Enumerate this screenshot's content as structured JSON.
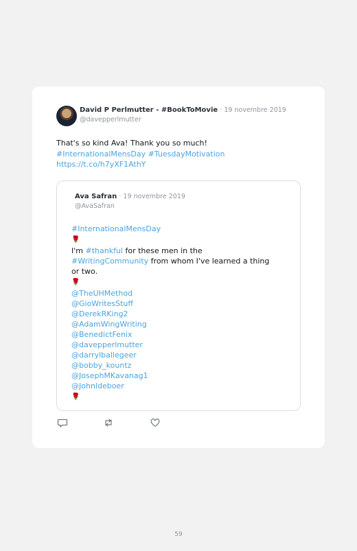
{
  "tweet": {
    "author_name": "David P Perlmutter - #BookToMovie",
    "date": "19 novembre 2019",
    "handle": "@davepperlmutter",
    "text_line1": "That's so kind Ava! Thank you so much!",
    "hashtag1": "#InternationalMensDay",
    "hashtag2": "#TuesdayMotivation",
    "link": "https://t.co/h7yXF1AthY"
  },
  "quoted_tweet": {
    "author_name": "Ava Safran",
    "date": "19 novembre 2019",
    "handle": "@AvaSafran",
    "hashtag": "#InternationalMensDay",
    "rose": "🌹",
    "text_a": "I'm ",
    "hashtag_thankful": "#thankful",
    "text_b": " for these men in the",
    "hashtag_writing": "#WritingCommunity",
    "text_c": " from whom I've learned a thing",
    "text_d": "or two.",
    "mentions": [
      "@TheUHMethod",
      "@GioWritesStuff",
      "@DerekRKing2",
      "@AdamWingWriting",
      "@BenedictFenix",
      "@davepperlmutter",
      "@darrylballegeer",
      "@bobby_kountz",
      "@JosephMKavanag1",
      "@Johnldeboer"
    ]
  },
  "actions": {
    "reply": "reply-icon",
    "retweet": "retweet-icon",
    "like": "heart-icon"
  },
  "colors": {
    "link": "#4aa3df",
    "meta": "#8e959d",
    "background": "#f2f2f3"
  },
  "page_number": "59"
}
